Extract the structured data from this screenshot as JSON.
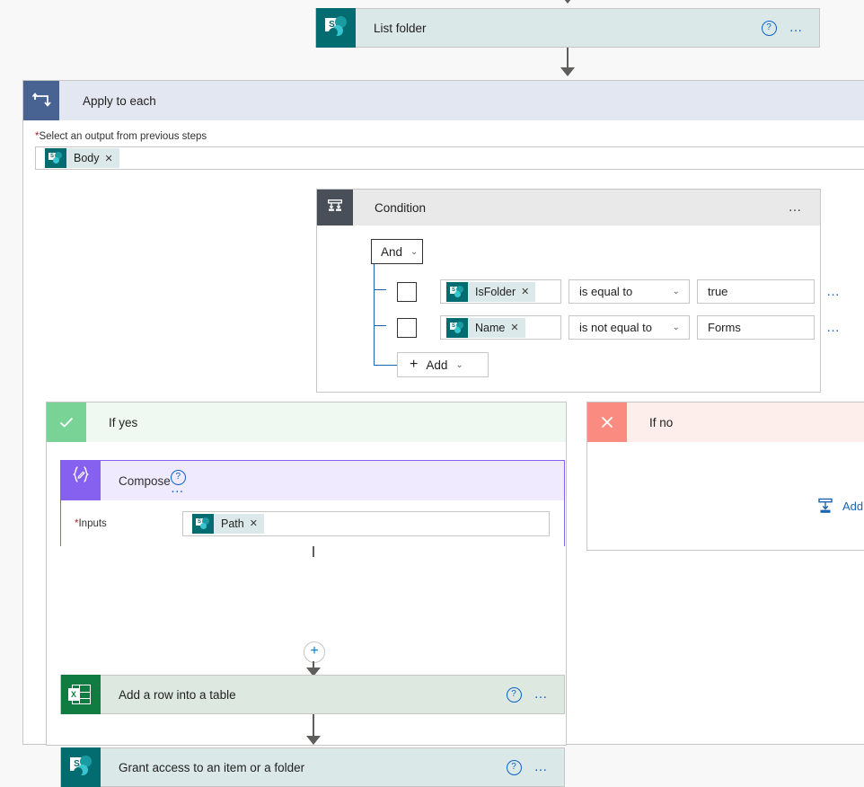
{
  "flow": {
    "top_action": {
      "title": "List folder",
      "icon": "sharepoint-icon",
      "help": "?",
      "menu": "…"
    },
    "apply_to_each": {
      "title": "Apply to each",
      "icon": "loop-icon",
      "field_label": "Select an output from previous steps",
      "required_marker": "*",
      "token": {
        "label": "Body",
        "remove": "✕",
        "icon": "sharepoint-icon"
      }
    },
    "condition": {
      "title": "Condition",
      "icon": "condition-icon",
      "menu": "…",
      "operator_group": {
        "value": "And",
        "chevron": "⌄"
      },
      "rows": [
        {
          "checkbox_checked": false,
          "token": {
            "label": "IsFolder",
            "remove": "✕",
            "icon": "sharepoint-icon"
          },
          "operator": "is equal to",
          "chevron": "⌄",
          "value": "true",
          "menu": "…"
        },
        {
          "checkbox_checked": false,
          "token": {
            "label": "Name",
            "remove": "✕",
            "icon": "sharepoint-icon"
          },
          "operator": "is not equal to",
          "chevron": "⌄",
          "value": "Forms",
          "menu": "…"
        }
      ],
      "add_button": {
        "plus": "+",
        "label": "Add",
        "chevron": "⌄"
      }
    },
    "if_yes": {
      "title": "If yes",
      "icon": "check-icon",
      "icon_glyph": "✓",
      "header_bg": "#7ad396",
      "panel_bg": "#eff9f1",
      "actions": [
        {
          "title": "Compose",
          "icon": "compose-icon",
          "icon_glyph": "{✎}",
          "help": "?",
          "menu": "…",
          "input_label": "Inputs",
          "required_marker": "*",
          "token": {
            "label": "Path",
            "remove": "✕",
            "icon": "sharepoint-icon"
          }
        },
        {
          "title": "Add a row into a table",
          "icon": "excel-icon",
          "help": "?",
          "menu": "…"
        },
        {
          "title": "Grant access to an item or a folder",
          "icon": "sharepoint-icon",
          "help": "?",
          "menu": "…"
        }
      ],
      "insert_node": "+"
    },
    "if_no": {
      "title": "If no",
      "icon": "cross-icon",
      "icon_glyph": "✕",
      "header_bg": "#f98b80",
      "panel_bg": "#fdeeec",
      "add_action": {
        "label": "Add an ac",
        "icon": "add-action-icon"
      }
    }
  },
  "colors": {
    "sharepoint": "#036c70",
    "excel": "#107c41",
    "compose": "#8661ef",
    "loop": "#486391",
    "condition": "#484f58",
    "link": "#1964b0",
    "required": "#a4262c"
  }
}
